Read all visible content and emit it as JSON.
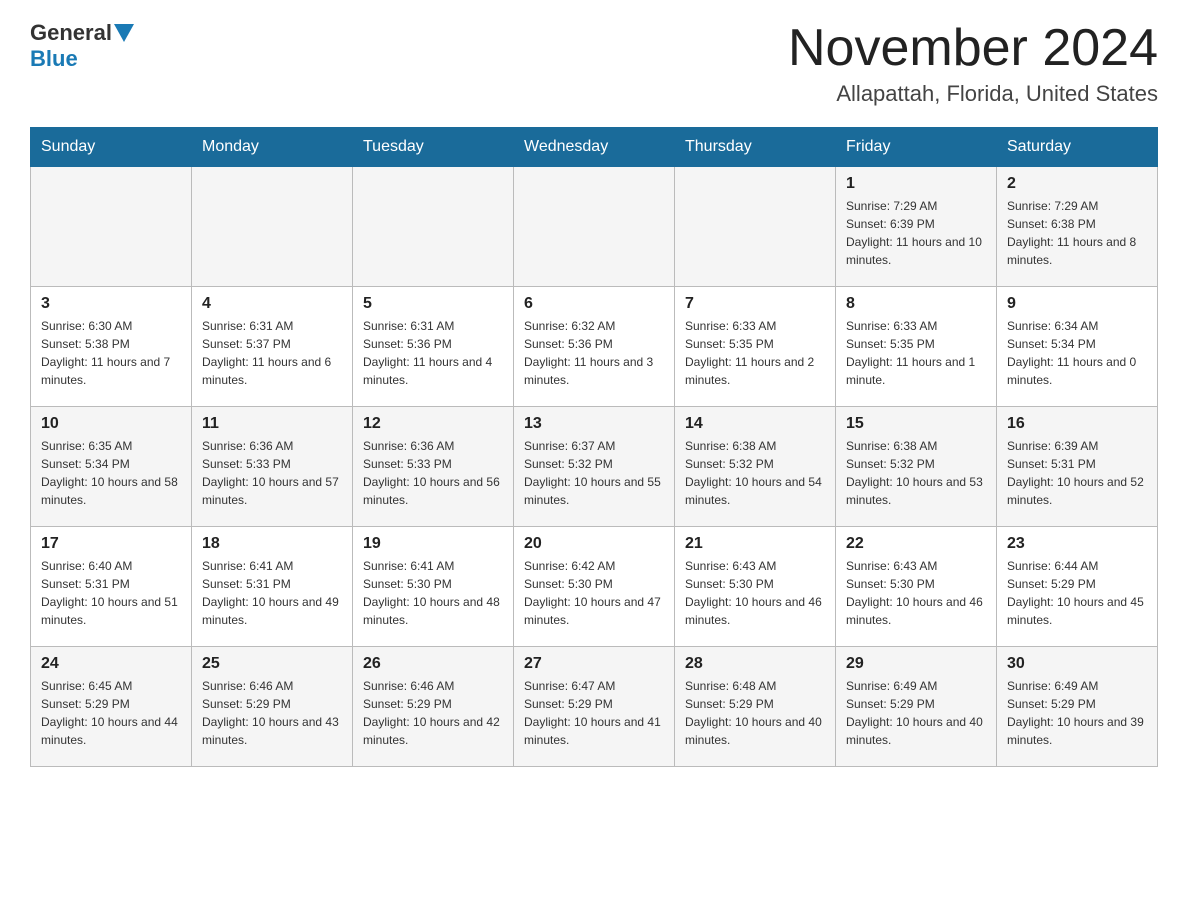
{
  "header": {
    "logo_general": "General",
    "logo_blue": "Blue",
    "month_title": "November 2024",
    "location": "Allapattah, Florida, United States"
  },
  "days_of_week": [
    "Sunday",
    "Monday",
    "Tuesday",
    "Wednesday",
    "Thursday",
    "Friday",
    "Saturday"
  ],
  "weeks": [
    [
      {
        "day": "",
        "sunrise": "",
        "sunset": "",
        "daylight": ""
      },
      {
        "day": "",
        "sunrise": "",
        "sunset": "",
        "daylight": ""
      },
      {
        "day": "",
        "sunrise": "",
        "sunset": "",
        "daylight": ""
      },
      {
        "day": "",
        "sunrise": "",
        "sunset": "",
        "daylight": ""
      },
      {
        "day": "",
        "sunrise": "",
        "sunset": "",
        "daylight": ""
      },
      {
        "day": "1",
        "sunrise": "Sunrise: 7:29 AM",
        "sunset": "Sunset: 6:39 PM",
        "daylight": "Daylight: 11 hours and 10 minutes."
      },
      {
        "day": "2",
        "sunrise": "Sunrise: 7:29 AM",
        "sunset": "Sunset: 6:38 PM",
        "daylight": "Daylight: 11 hours and 8 minutes."
      }
    ],
    [
      {
        "day": "3",
        "sunrise": "Sunrise: 6:30 AM",
        "sunset": "Sunset: 5:38 PM",
        "daylight": "Daylight: 11 hours and 7 minutes."
      },
      {
        "day": "4",
        "sunrise": "Sunrise: 6:31 AM",
        "sunset": "Sunset: 5:37 PM",
        "daylight": "Daylight: 11 hours and 6 minutes."
      },
      {
        "day": "5",
        "sunrise": "Sunrise: 6:31 AM",
        "sunset": "Sunset: 5:36 PM",
        "daylight": "Daylight: 11 hours and 4 minutes."
      },
      {
        "day": "6",
        "sunrise": "Sunrise: 6:32 AM",
        "sunset": "Sunset: 5:36 PM",
        "daylight": "Daylight: 11 hours and 3 minutes."
      },
      {
        "day": "7",
        "sunrise": "Sunrise: 6:33 AM",
        "sunset": "Sunset: 5:35 PM",
        "daylight": "Daylight: 11 hours and 2 minutes."
      },
      {
        "day": "8",
        "sunrise": "Sunrise: 6:33 AM",
        "sunset": "Sunset: 5:35 PM",
        "daylight": "Daylight: 11 hours and 1 minute."
      },
      {
        "day": "9",
        "sunrise": "Sunrise: 6:34 AM",
        "sunset": "Sunset: 5:34 PM",
        "daylight": "Daylight: 11 hours and 0 minutes."
      }
    ],
    [
      {
        "day": "10",
        "sunrise": "Sunrise: 6:35 AM",
        "sunset": "Sunset: 5:34 PM",
        "daylight": "Daylight: 10 hours and 58 minutes."
      },
      {
        "day": "11",
        "sunrise": "Sunrise: 6:36 AM",
        "sunset": "Sunset: 5:33 PM",
        "daylight": "Daylight: 10 hours and 57 minutes."
      },
      {
        "day": "12",
        "sunrise": "Sunrise: 6:36 AM",
        "sunset": "Sunset: 5:33 PM",
        "daylight": "Daylight: 10 hours and 56 minutes."
      },
      {
        "day": "13",
        "sunrise": "Sunrise: 6:37 AM",
        "sunset": "Sunset: 5:32 PM",
        "daylight": "Daylight: 10 hours and 55 minutes."
      },
      {
        "day": "14",
        "sunrise": "Sunrise: 6:38 AM",
        "sunset": "Sunset: 5:32 PM",
        "daylight": "Daylight: 10 hours and 54 minutes."
      },
      {
        "day": "15",
        "sunrise": "Sunrise: 6:38 AM",
        "sunset": "Sunset: 5:32 PM",
        "daylight": "Daylight: 10 hours and 53 minutes."
      },
      {
        "day": "16",
        "sunrise": "Sunrise: 6:39 AM",
        "sunset": "Sunset: 5:31 PM",
        "daylight": "Daylight: 10 hours and 52 minutes."
      }
    ],
    [
      {
        "day": "17",
        "sunrise": "Sunrise: 6:40 AM",
        "sunset": "Sunset: 5:31 PM",
        "daylight": "Daylight: 10 hours and 51 minutes."
      },
      {
        "day": "18",
        "sunrise": "Sunrise: 6:41 AM",
        "sunset": "Sunset: 5:31 PM",
        "daylight": "Daylight: 10 hours and 49 minutes."
      },
      {
        "day": "19",
        "sunrise": "Sunrise: 6:41 AM",
        "sunset": "Sunset: 5:30 PM",
        "daylight": "Daylight: 10 hours and 48 minutes."
      },
      {
        "day": "20",
        "sunrise": "Sunrise: 6:42 AM",
        "sunset": "Sunset: 5:30 PM",
        "daylight": "Daylight: 10 hours and 47 minutes."
      },
      {
        "day": "21",
        "sunrise": "Sunrise: 6:43 AM",
        "sunset": "Sunset: 5:30 PM",
        "daylight": "Daylight: 10 hours and 46 minutes."
      },
      {
        "day": "22",
        "sunrise": "Sunrise: 6:43 AM",
        "sunset": "Sunset: 5:30 PM",
        "daylight": "Daylight: 10 hours and 46 minutes."
      },
      {
        "day": "23",
        "sunrise": "Sunrise: 6:44 AM",
        "sunset": "Sunset: 5:29 PM",
        "daylight": "Daylight: 10 hours and 45 minutes."
      }
    ],
    [
      {
        "day": "24",
        "sunrise": "Sunrise: 6:45 AM",
        "sunset": "Sunset: 5:29 PM",
        "daylight": "Daylight: 10 hours and 44 minutes."
      },
      {
        "day": "25",
        "sunrise": "Sunrise: 6:46 AM",
        "sunset": "Sunset: 5:29 PM",
        "daylight": "Daylight: 10 hours and 43 minutes."
      },
      {
        "day": "26",
        "sunrise": "Sunrise: 6:46 AM",
        "sunset": "Sunset: 5:29 PM",
        "daylight": "Daylight: 10 hours and 42 minutes."
      },
      {
        "day": "27",
        "sunrise": "Sunrise: 6:47 AM",
        "sunset": "Sunset: 5:29 PM",
        "daylight": "Daylight: 10 hours and 41 minutes."
      },
      {
        "day": "28",
        "sunrise": "Sunrise: 6:48 AM",
        "sunset": "Sunset: 5:29 PM",
        "daylight": "Daylight: 10 hours and 40 minutes."
      },
      {
        "day": "29",
        "sunrise": "Sunrise: 6:49 AM",
        "sunset": "Sunset: 5:29 PM",
        "daylight": "Daylight: 10 hours and 40 minutes."
      },
      {
        "day": "30",
        "sunrise": "Sunrise: 6:49 AM",
        "sunset": "Sunset: 5:29 PM",
        "daylight": "Daylight: 10 hours and 39 minutes."
      }
    ]
  ]
}
